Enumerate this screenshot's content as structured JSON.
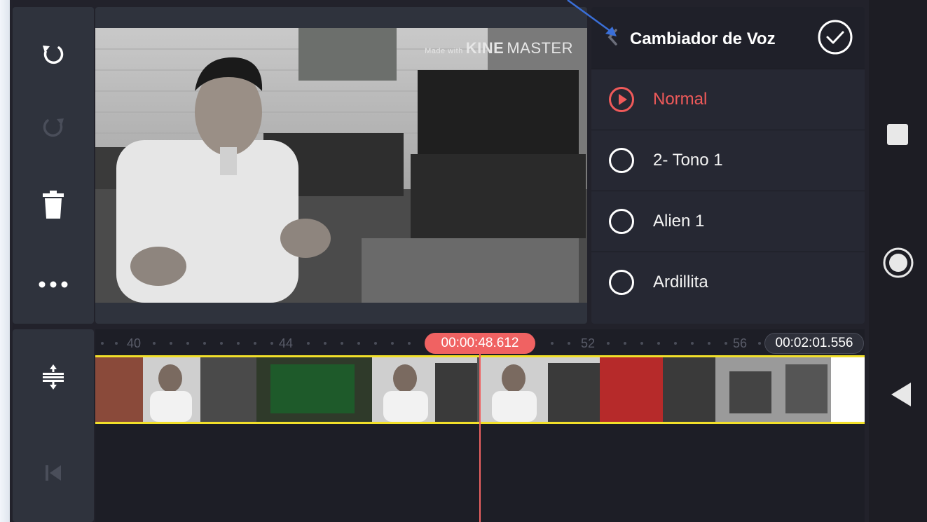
{
  "app": {
    "watermark_prefix": "Made with",
    "watermark_brand": "KINE",
    "watermark_brand2": "MASTER"
  },
  "toolbar": {
    "undo": "undo-icon",
    "redo": "redo-icon",
    "delete": "trash-icon",
    "more": "more-icon",
    "expand": "expand-tracks-icon",
    "jump_start": "jump-to-start-icon"
  },
  "voice_changer": {
    "title": "Cambiador de Voz",
    "options": [
      {
        "label": "Normal",
        "selected": true
      },
      {
        "label": "2- Tono 1",
        "selected": false
      },
      {
        "label": "Alien 1",
        "selected": false
      },
      {
        "label": "Ardillita",
        "selected": false
      }
    ]
  },
  "timeline": {
    "ticks": [
      "40",
      "44",
      "52",
      "56"
    ],
    "current_time": "00:00:48.612",
    "total_time": "00:02:01.556"
  },
  "system_nav": {
    "recents": "square-icon",
    "home": "circle-icon",
    "back": "triangle-back-icon"
  },
  "colors": {
    "accent": "#f06262",
    "track_border": "#f2e02a",
    "selected_text": "#f05a5a"
  }
}
